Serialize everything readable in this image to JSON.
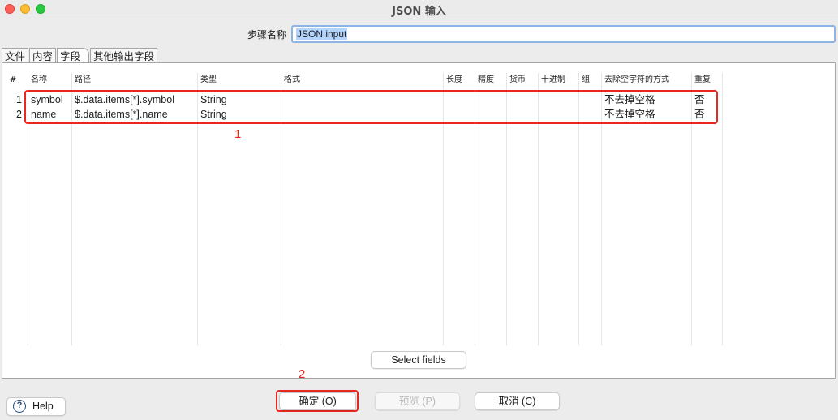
{
  "window": {
    "title": "JSON 输入"
  },
  "step": {
    "label": "步骤名称",
    "value": "JSON input"
  },
  "tabs": [
    {
      "label": "文件",
      "active": false
    },
    {
      "label": "内容",
      "active": false
    },
    {
      "label": "字段",
      "active": true
    },
    {
      "label": "其他输出字段",
      "active": false
    }
  ],
  "grid": {
    "headers": [
      "#",
      "名称",
      "路径",
      "类型",
      "格式",
      "长度",
      "精度",
      "货币",
      "十进制",
      "组",
      "去除空字符的方式",
      "重复"
    ],
    "rows": [
      {
        "num": "1",
        "name": "symbol",
        "path": "$.data.items[*].symbol",
        "type": "String",
        "trim": "不去掉空格",
        "repeat": "否"
      },
      {
        "num": "2",
        "name": "name",
        "path": "$.data.items[*].name",
        "type": "String",
        "trim": "不去掉空格",
        "repeat": "否"
      }
    ]
  },
  "annotations": {
    "one": "1",
    "two": "2",
    "color": "#e8281f"
  },
  "buttons": {
    "select_fields": "Select fields",
    "ok": "确定 (O)",
    "preview": "预览 (P)",
    "cancel": "取消 (C)",
    "help": "Help"
  },
  "icons": {
    "help": "question-circle-icon"
  }
}
